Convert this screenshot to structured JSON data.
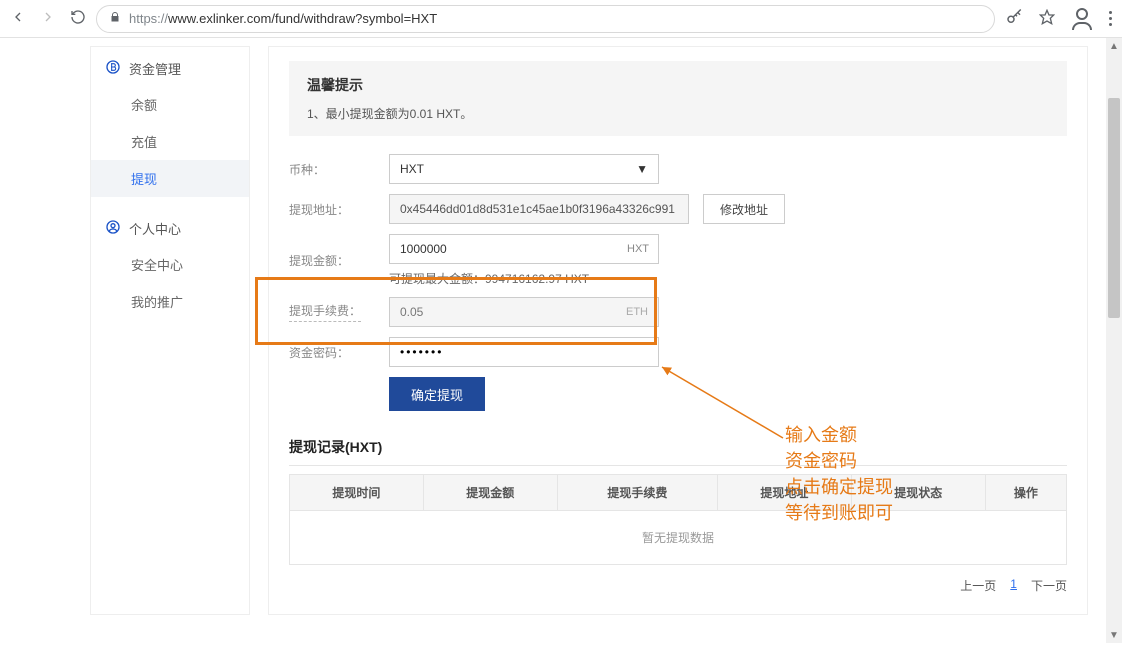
{
  "chrome": {
    "url_prefix": "https://",
    "url_rest": "www.exlinker.com/fund/withdraw?symbol=HXT"
  },
  "sidebar": {
    "section_fund": {
      "title": "资金管理",
      "items": [
        "余额",
        "充值",
        "提现"
      ],
      "active_index": 2
    },
    "section_user": {
      "title": "个人中心",
      "items": [
        "安全中心",
        "我的推广"
      ]
    }
  },
  "notice": {
    "title": "温馨提示",
    "line1": "1、最小提现金额为0.01 HXT。"
  },
  "form": {
    "coin_label": "币种：",
    "coin_value": "HXT",
    "addr_label": "提现地址：",
    "addr_value": "0x45446dd01d8d531e1c45ae1b0f3196a43326c991",
    "addr_btn": "修改地址",
    "amount_label": "提现金额：",
    "amount_value": "1000000",
    "amount_suffix": "HXT",
    "amount_helper": "可提现最大金额：994716162.97 HXT",
    "fee_label": "提现手续费：",
    "fee_value": "0.05",
    "fee_suffix": "ETH",
    "pwd_label": "资金密码：",
    "pwd_value": "•••••••",
    "submit": "确定提现"
  },
  "records": {
    "title": "提现记录(HXT)",
    "columns": [
      "提现时间",
      "提现金额",
      "提现手续费",
      "提现地址",
      "提现状态",
      "操作"
    ],
    "empty": "暂无提现数据"
  },
  "pager": {
    "prev": "上一页",
    "page": "1",
    "next": "下一页"
  },
  "annotation": {
    "lines": [
      "输入金额",
      "资金密码",
      "点击确定提现",
      "等待到账即可"
    ]
  }
}
